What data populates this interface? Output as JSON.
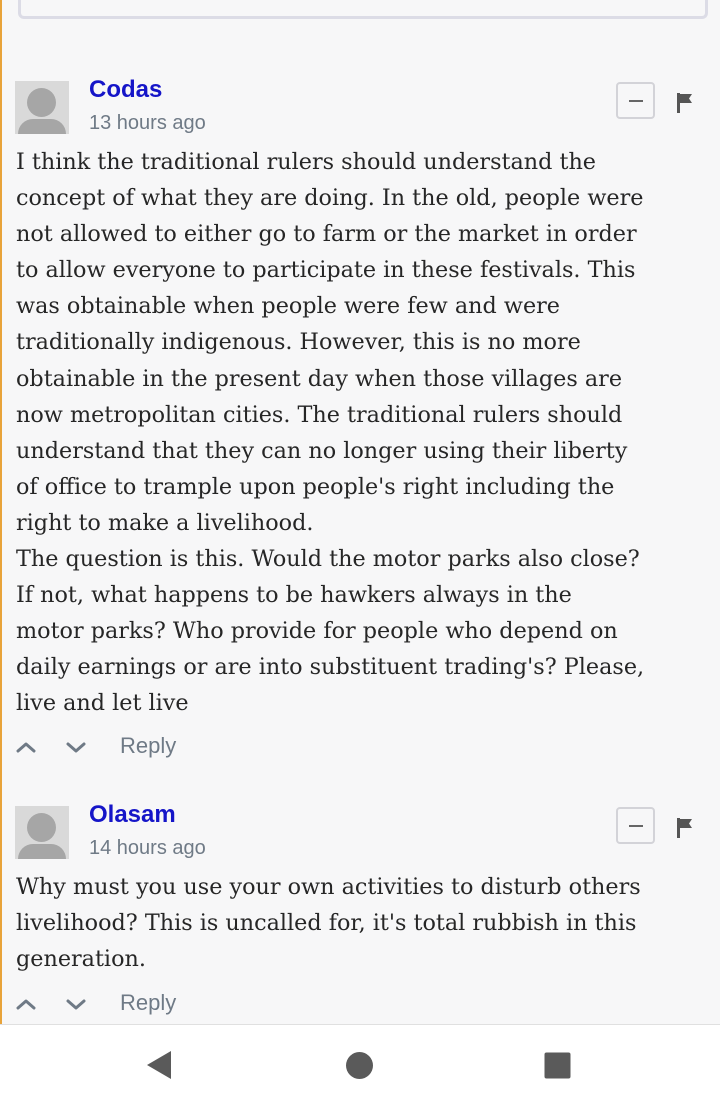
{
  "comments": [
    {
      "author": "Codas",
      "time": "13 hours ago",
      "lines": [
        "I think the traditional rulers should understand the",
        "concept of what they are doing. In the old, people were",
        "not allowed to either go to farm or the market in order",
        "to allow everyone to participate in these festivals. This",
        "was obtainable when people were few and were",
        "traditionally indigenous. However, this is no more",
        "obtainable in the present day when those villages are",
        "now metropolitan cities. The traditional rulers should",
        "understand that they can no longer using their liberty",
        "of office to trample upon people's right including the",
        "right to make a livelihood.",
        "The question is this. Would the motor parks also close?",
        "If not, what happens to be hawkers always in the",
        "motor parks? Who provide for people who depend on",
        "daily earnings or are into substituent trading's? Please,",
        "live and let live"
      ],
      "reply_label": "Reply"
    },
    {
      "author": "Olasam",
      "time": "14 hours ago",
      "lines": [
        "Why must you use your own activities to disturb others",
        "livelihood? This is uncalled for, it's total rubbish in this",
        "generation."
      ],
      "reply_label": "Reply"
    }
  ],
  "icons": {
    "avatar": "default-avatar-icon",
    "collapse": "minus-icon",
    "flag": "flag-icon",
    "upvote": "chevron-up-icon",
    "downvote": "chevron-down-icon",
    "nav_back": "back-triangle-icon",
    "nav_home": "home-circle-icon",
    "nav_recents": "recents-square-icon"
  },
  "colors": {
    "author": "#1515c8",
    "meta": "#6f7a86",
    "body": "#262626",
    "accent_border": "#e8a33a"
  }
}
